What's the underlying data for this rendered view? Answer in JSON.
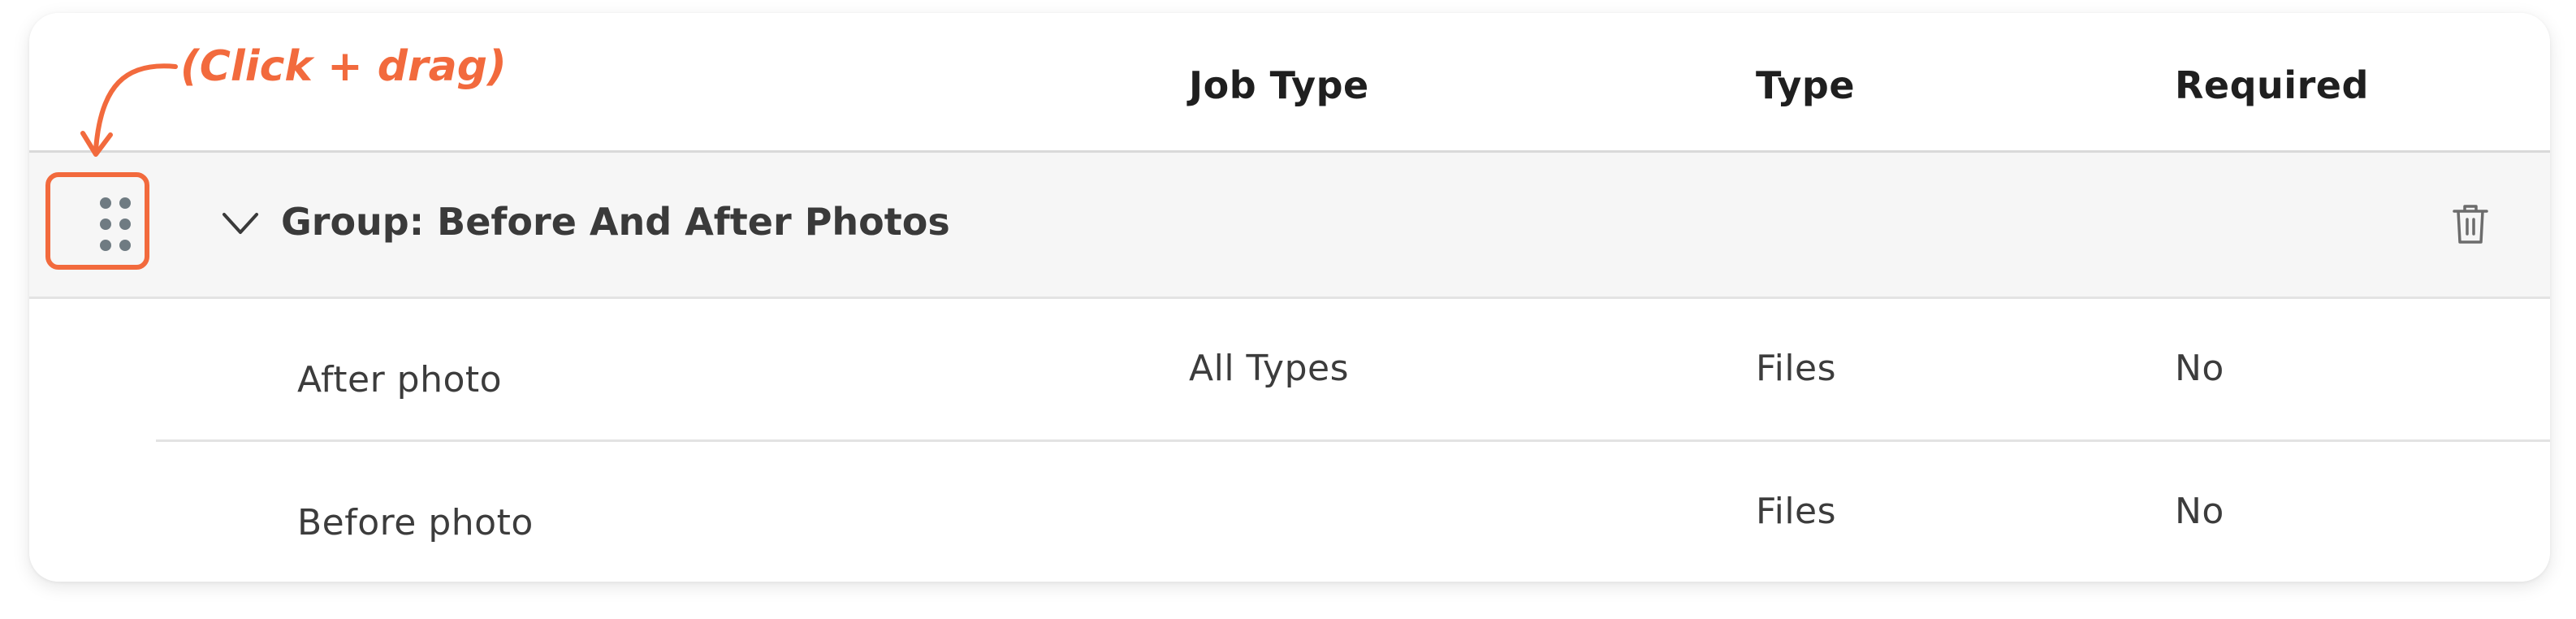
{
  "table": {
    "columns": [
      "Job Type",
      "Type",
      "Required"
    ],
    "group": {
      "title": "Group: Before And After Photos",
      "expanded_icon": "chevron-down-icon",
      "drag_icon": "drag-handle-icon",
      "delete_icon": "trash-icon"
    },
    "rows": [
      {
        "name": "After photo",
        "job_type": "All Types",
        "type": "Files",
        "required": "No"
      },
      {
        "name": "Before photo",
        "job_type": "",
        "type": "Files",
        "required": "No"
      }
    ]
  },
  "annotation": {
    "text": "(Click + drag)",
    "color": "#f26a3d"
  },
  "colors": {
    "group_row_bg": "#f6f6f6",
    "text": "#3c3c3c",
    "accent": "#f26a3d"
  }
}
